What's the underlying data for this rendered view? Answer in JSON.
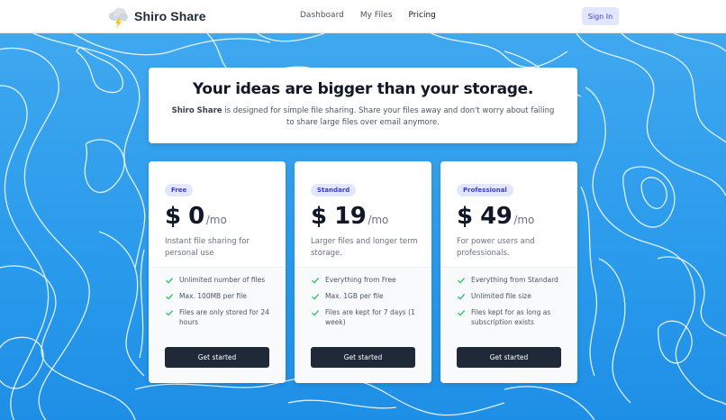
{
  "nav": {
    "brand": "Shiro Share",
    "links": [
      "Dashboard",
      "My Files",
      "Pricing"
    ],
    "active_link": "Pricing",
    "signin_label": "Sign In"
  },
  "banner": {
    "title": "Your ideas are bigger than your storage.",
    "brand_strong": "Shiro Share",
    "description_rest": " is designed for simple file sharing. Share your files away and don't worry about failing to share large files over email anymore."
  },
  "plans": [
    {
      "badge": "Free",
      "amount": "$ 0",
      "period": "/mo",
      "description": "Instant file sharing for personal use",
      "features": [
        "Unlimited number of files",
        "Max. 100MB per file",
        "Files are only stored for 24 hours"
      ],
      "cta": "Get started"
    },
    {
      "badge": "Standard",
      "amount": "$ 19",
      "period": "/mo",
      "description": "Larger files and longer term storage.",
      "features": [
        "Everything from Free",
        "Max. 1GB per file",
        "Files are kept for 7 days (1 week)"
      ],
      "cta": "Get started"
    },
    {
      "badge": "Professional",
      "amount": "$ 49",
      "period": "/mo",
      "description": "For power users and professionals.",
      "features": [
        "Everything from Standard",
        "Unlimited file size",
        "Files kept for as long as subscription exists"
      ],
      "cta": "Get started"
    }
  ],
  "icons": {
    "brand": "cloud-lightning-icon",
    "feature": "check-icon"
  },
  "colors": {
    "accent": "#4338ca",
    "badge_bg": "#e0e7ff",
    "check": "#22c55e",
    "cta_bg": "#1f2937",
    "hero_bg": "#2b9bec"
  }
}
